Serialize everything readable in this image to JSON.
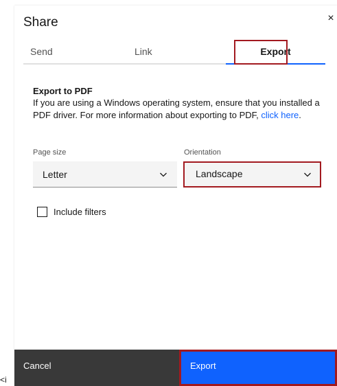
{
  "modal": {
    "title": "Share",
    "close_glyph": "×"
  },
  "tabs": [
    {
      "label": "Send",
      "selected": false
    },
    {
      "label": "Link",
      "selected": false
    },
    {
      "label": "Export",
      "selected": true
    }
  ],
  "export": {
    "section_title": "Export to PDF",
    "description": "If you are using a Windows operating system, ensure that you installed a PDF driver. For more information about exporting to PDF, ",
    "link_text": "click here",
    "link_suffix": "."
  },
  "page_size": {
    "label": "Page size",
    "value": "Letter"
  },
  "orientation": {
    "label": "Orientation",
    "value": "Landscape"
  },
  "include_filters": {
    "label": "Include filters",
    "checked": false
  },
  "footer": {
    "cancel_label": "Cancel",
    "export_label": "Export"
  },
  "stray_text": "<i",
  "colors": {
    "accent": "#0f62fe",
    "highlight": "#a2191f",
    "cancel_bg": "#393939"
  }
}
